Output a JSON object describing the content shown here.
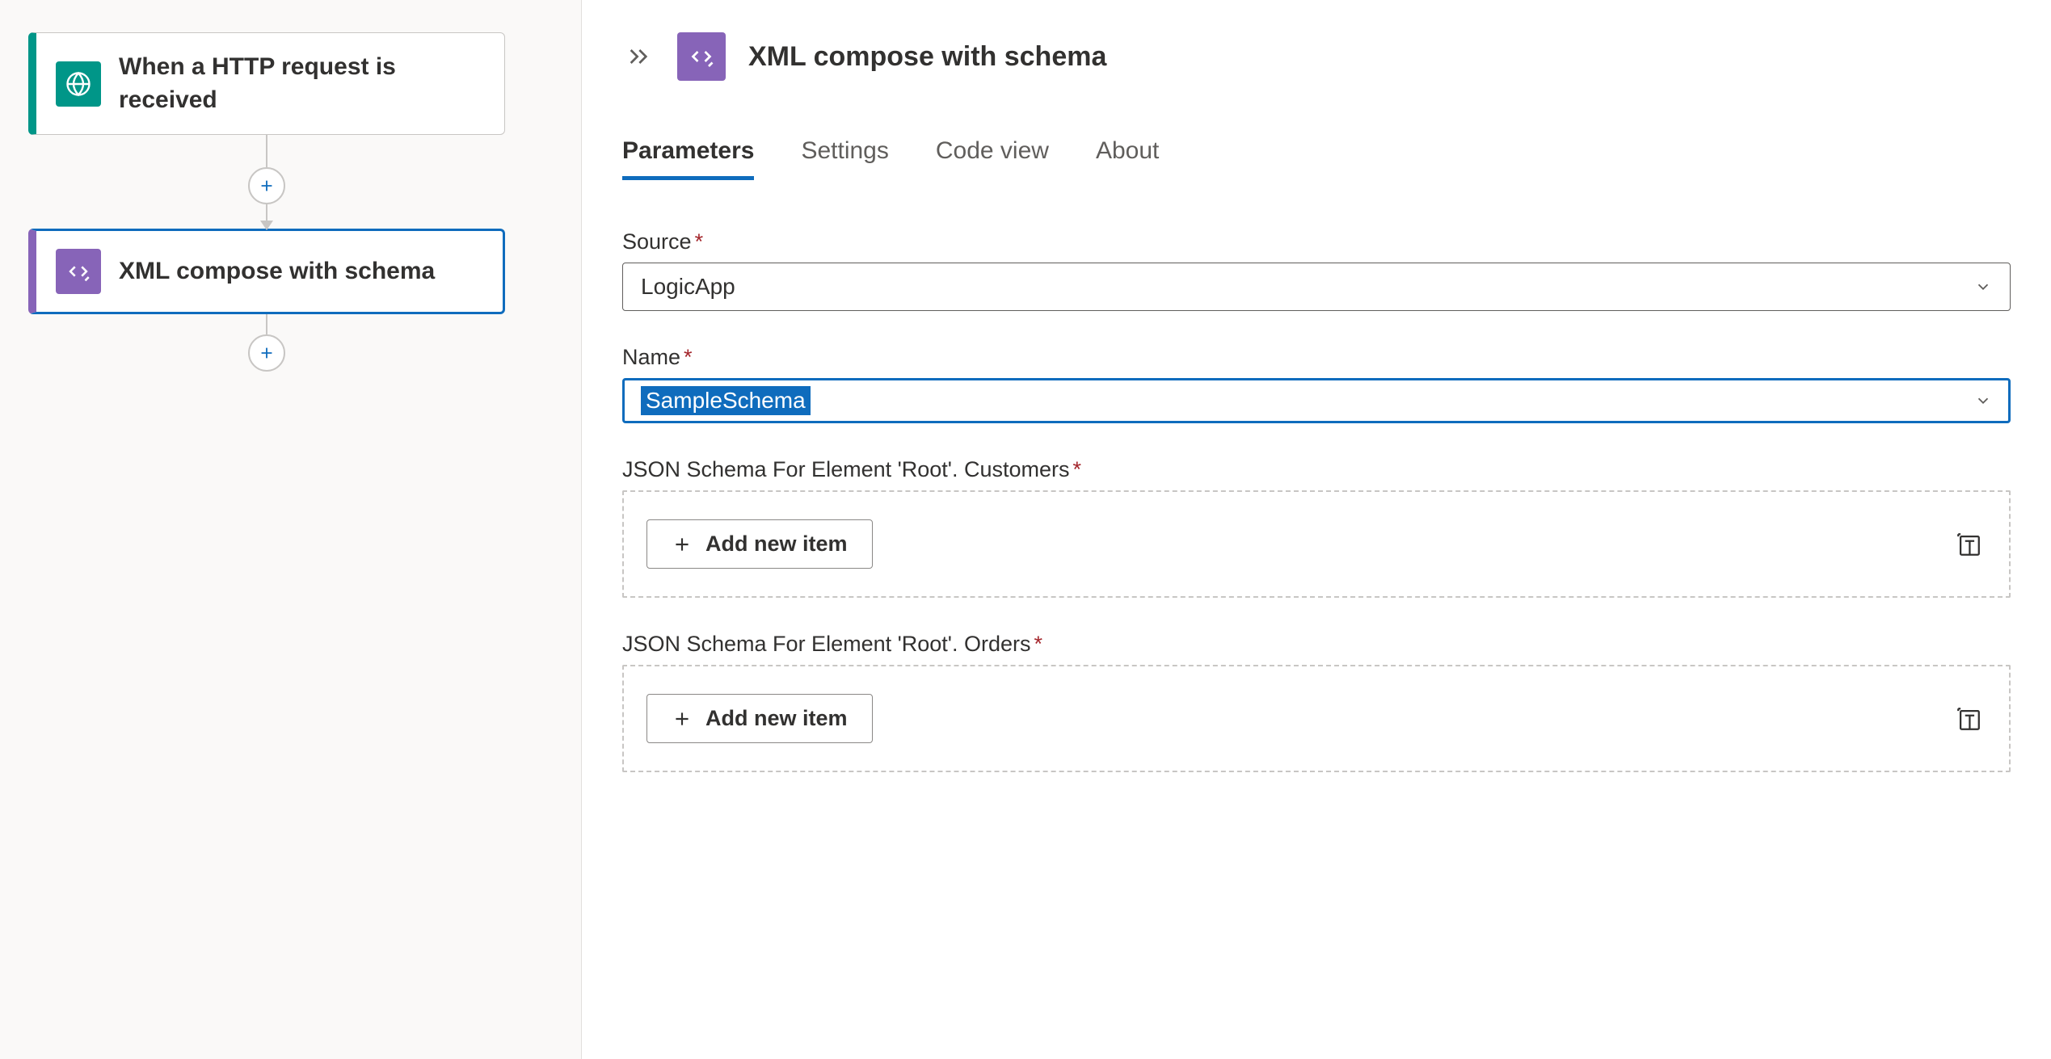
{
  "canvas": {
    "trigger": {
      "label": "When a HTTP request is received"
    },
    "action": {
      "label": "XML compose with schema"
    }
  },
  "panel": {
    "title": "XML compose with schema",
    "tabs": {
      "parameters": "Parameters",
      "settings": "Settings",
      "code_view": "Code view",
      "about": "About"
    },
    "fields": {
      "source": {
        "label": "Source",
        "value": "LogicApp"
      },
      "name": {
        "label": "Name",
        "value": "SampleSchema"
      },
      "customers": {
        "label": "JSON Schema For Element 'Root'. Customers",
        "add_label": "Add new item"
      },
      "orders": {
        "label": "JSON Schema For Element 'Root'. Orders",
        "add_label": "Add new item"
      }
    }
  }
}
